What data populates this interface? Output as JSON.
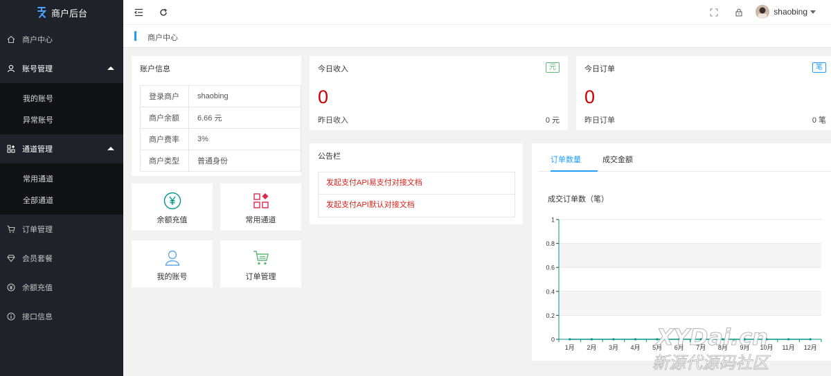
{
  "app": {
    "title": "商户后台"
  },
  "sidebar": {
    "items": [
      {
        "label": "商户中心",
        "icon": "home-icon"
      },
      {
        "label": "账号管理",
        "icon": "user-icon",
        "expanded": true,
        "children": [
          {
            "label": "我的账号"
          },
          {
            "label": "异常账号"
          }
        ]
      },
      {
        "label": "通道管理",
        "icon": "apps-icon",
        "expanded": true,
        "children": [
          {
            "label": "常用通道"
          },
          {
            "label": "全部通道"
          }
        ]
      },
      {
        "label": "订单管理",
        "icon": "cart-icon"
      },
      {
        "label": "会员套餐",
        "icon": "diamond-icon"
      },
      {
        "label": "余额充值",
        "icon": "yen-icon"
      },
      {
        "label": "接口信息",
        "icon": "info-icon"
      }
    ]
  },
  "header": {
    "icons": [
      "menu-fold-icon",
      "refresh-icon",
      "fullscreen-icon",
      "lock-icon"
    ],
    "user": "shaobing"
  },
  "breadcrumb": {
    "label": "商户中心"
  },
  "account": {
    "title": "账户信息",
    "rows": [
      {
        "key": "登录商户",
        "value": "shaobing"
      },
      {
        "key": "商户余额",
        "value": "6.66 元"
      },
      {
        "key": "商户费率",
        "value": "3%"
      },
      {
        "key": "商户类型",
        "value": "普通身份"
      }
    ]
  },
  "quick_links": [
    {
      "label": "余额充值",
      "icon": "yen-circle-icon",
      "color": "#009688"
    },
    {
      "label": "常用通道",
      "icon": "grid-diamond-icon",
      "color": "#e0284d"
    },
    {
      "label": "我的账号",
      "icon": "user-outline-icon",
      "color": "#62a8ea"
    },
    {
      "label": "订单管理",
      "icon": "cart-icon",
      "color": "#5fb878"
    }
  ],
  "income": {
    "title": "今日收入",
    "badge": "元",
    "value": "0",
    "sub_label": "昨日收入",
    "sub_value": "0 元",
    "badge_color": "#5fb878"
  },
  "orders": {
    "title": "今日订单",
    "badge": "笔",
    "value": "0",
    "sub_label": "昨日订单",
    "sub_value": "0 笔",
    "badge_color": "#1e9fff"
  },
  "notice": {
    "title": "公告栏",
    "items": [
      "发起支付API易支付对接文档",
      "发起支付API默认对接文档"
    ]
  },
  "chart_panel": {
    "tabs": [
      "订单数量",
      "成交金额"
    ],
    "active_tab": 0,
    "chart_title": "成交订单数（笔）"
  },
  "chart_data": {
    "type": "line",
    "title": "成交订单数（笔）",
    "categories": [
      "1月",
      "2月",
      "3月",
      "4月",
      "5月",
      "6月",
      "7月",
      "8月",
      "9月",
      "10月",
      "11月",
      "12月"
    ],
    "y_ticks": [
      "0",
      "0.2",
      "0.4",
      "0.6",
      "0.8",
      "1"
    ],
    "series": [
      {
        "values": [
          0,
          0,
          0,
          0,
          0,
          0,
          0,
          0,
          0,
          0,
          0,
          0
        ]
      }
    ],
    "ylim": [
      0,
      1
    ],
    "color": "#009688"
  },
  "watermark": {
    "line1": "XYDai.cn",
    "line2": "新源代源码社区"
  }
}
